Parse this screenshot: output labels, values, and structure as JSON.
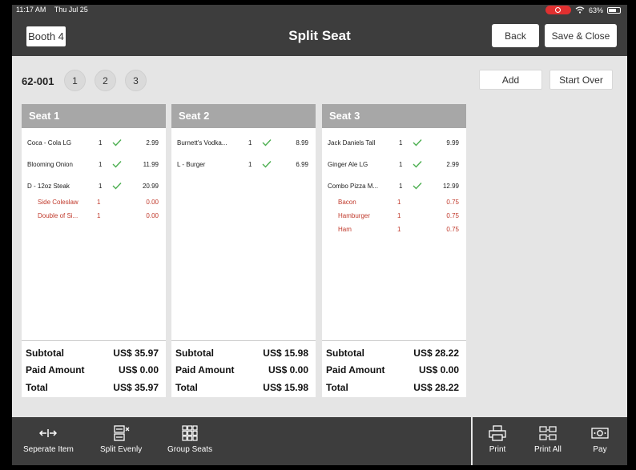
{
  "status": {
    "time": "11:17 AM",
    "date": "Thu Jul 25",
    "battery": "63%"
  },
  "header": {
    "table_label": "Booth 4",
    "title": "Split Seat",
    "back_label": "Back",
    "save_label": "Save & Close"
  },
  "order": {
    "id": "62-001",
    "seat_tabs": [
      "1",
      "2",
      "3"
    ],
    "add_label": "Add",
    "start_over_label": "Start Over"
  },
  "seats": [
    {
      "title": "Seat 1",
      "items": [
        {
          "name": "Coca - Cola LG",
          "qty": "1",
          "price": "2.99",
          "sent": true,
          "modifier": false
        },
        {
          "name": "Blooming Onion",
          "qty": "1",
          "price": "11.99",
          "sent": true,
          "modifier": false
        },
        {
          "name": "D - 12oz Steak",
          "qty": "1",
          "price": "20.99",
          "sent": true,
          "modifier": false
        },
        {
          "name": "Side Coleslaw",
          "qty": "1",
          "price": "0.00",
          "sent": false,
          "modifier": true
        },
        {
          "name": "Double of Si...",
          "qty": "1",
          "price": "0.00",
          "sent": false,
          "modifier": true
        }
      ],
      "totals": [
        {
          "label": "Subtotal",
          "value": "US$ 35.97"
        },
        {
          "label": "Paid Amount",
          "value": "US$ 0.00"
        },
        {
          "label": "Total",
          "value": "US$ 35.97"
        }
      ]
    },
    {
      "title": "Seat 2",
      "items": [
        {
          "name": "Burnett's Vodka...",
          "qty": "1",
          "price": "8.99",
          "sent": true,
          "modifier": false
        },
        {
          "name": "L - Burger",
          "qty": "1",
          "price": "6.99",
          "sent": true,
          "modifier": false
        }
      ],
      "totals": [
        {
          "label": "Subtotal",
          "value": "US$ 15.98"
        },
        {
          "label": "Paid Amount",
          "value": "US$ 0.00"
        },
        {
          "label": "Total",
          "value": "US$ 15.98"
        }
      ]
    },
    {
      "title": "Seat 3",
      "items": [
        {
          "name": "Jack Daniels Tall",
          "qty": "1",
          "price": "9.99",
          "sent": true,
          "modifier": false
        },
        {
          "name": "Ginger Ale LG",
          "qty": "1",
          "price": "2.99",
          "sent": true,
          "modifier": false
        },
        {
          "name": "Combo Pizza M...",
          "qty": "1",
          "price": "12.99",
          "sent": true,
          "modifier": false
        },
        {
          "name": "Bacon",
          "qty": "1",
          "price": "0.75",
          "sent": false,
          "modifier": true
        },
        {
          "name": "Hamburger",
          "qty": "1",
          "price": "0.75",
          "sent": false,
          "modifier": true
        },
        {
          "name": "Ham",
          "qty": "1",
          "price": "0.75",
          "sent": false,
          "modifier": true
        }
      ],
      "totals": [
        {
          "label": "Subtotal",
          "value": "US$ 28.22"
        },
        {
          "label": "Paid Amount",
          "value": "US$ 0.00"
        },
        {
          "label": "Total",
          "value": "US$ 28.22"
        }
      ]
    }
  ],
  "toolbar": {
    "left": [
      {
        "label": "Seperate Item",
        "icon": "separate-arrows-icon"
      },
      {
        "label": "Split Evenly",
        "icon": "split-evenly-icon"
      },
      {
        "label": "Group Seats",
        "icon": "grid-icon"
      }
    ],
    "right": [
      {
        "label": "Print",
        "icon": "printer-icon"
      },
      {
        "label": "Print All",
        "icon": "print-all-icon"
      },
      {
        "label": "Pay",
        "icon": "cash-icon"
      }
    ]
  },
  "colors": {
    "header": "#3d3d3d",
    "seat_header": "#a7a7a7",
    "modifier_text": "#c0392b",
    "check": "#4caf50"
  }
}
